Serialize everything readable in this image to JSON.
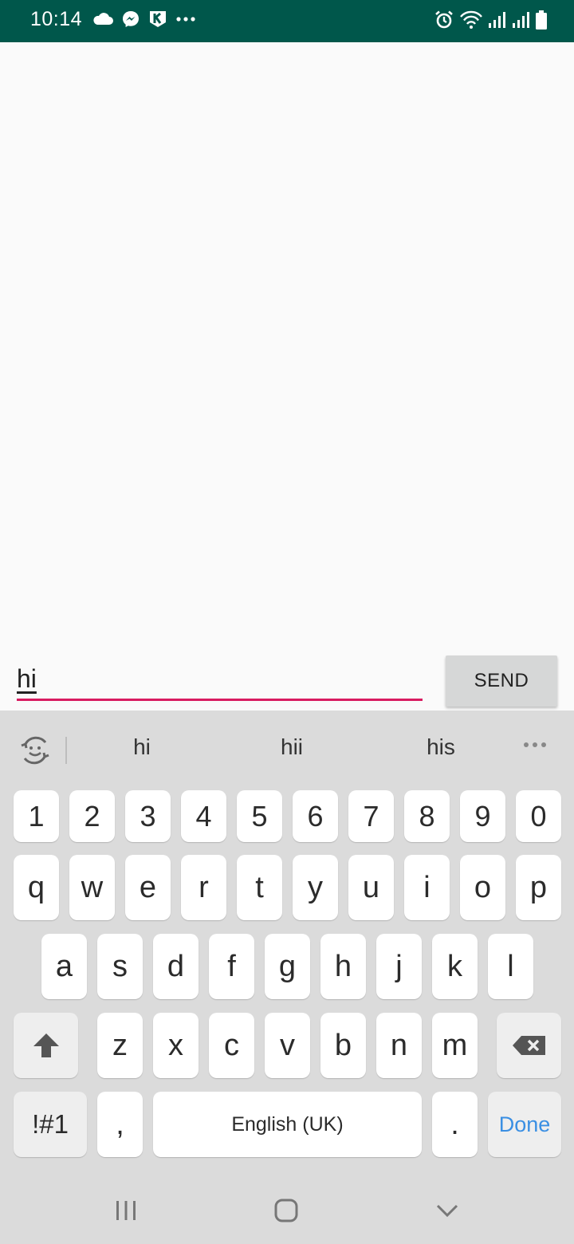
{
  "status_bar": {
    "time": "10:14",
    "background": "#00574b",
    "left_icons": [
      "cloud-icon",
      "messenger-icon",
      "k-app-icon",
      "more-dots-icon"
    ],
    "right_icons": [
      "alarm-icon",
      "wifi-icon",
      "signal-icon",
      "signal-icon",
      "battery-icon"
    ]
  },
  "composer": {
    "input_value": "hi",
    "send_label": "SEND",
    "accent": "#d81b60"
  },
  "keyboard": {
    "suggestions": [
      "hi",
      "hii",
      "his"
    ],
    "number_row": [
      "1",
      "2",
      "3",
      "4",
      "5",
      "6",
      "7",
      "8",
      "9",
      "0"
    ],
    "row1": [
      "q",
      "w",
      "e",
      "r",
      "t",
      "y",
      "u",
      "i",
      "o",
      "p"
    ],
    "row2": [
      "a",
      "s",
      "d",
      "f",
      "g",
      "h",
      "j",
      "k",
      "l"
    ],
    "row3": [
      "z",
      "x",
      "c",
      "v",
      "b",
      "n",
      "m"
    ],
    "symbols_label": "!#1",
    "comma_label": ",",
    "space_label": "English (UK)",
    "period_label": ".",
    "done_label": "Done",
    "done_color": "#3a8fe3"
  },
  "nav_bar": {
    "buttons": [
      "recents-icon",
      "home-icon",
      "back-chevron-icon"
    ]
  }
}
